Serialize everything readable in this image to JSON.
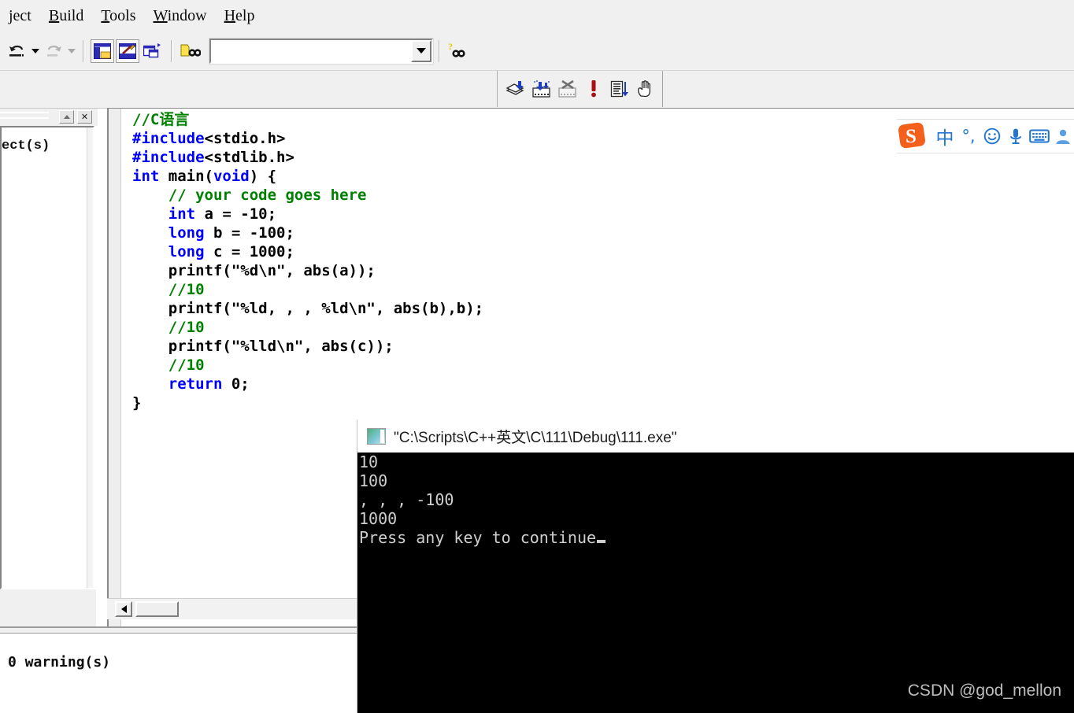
{
  "menu": {
    "items": [
      {
        "label": "ject",
        "accel": ""
      },
      {
        "label": "Build",
        "accel": "B"
      },
      {
        "label": "Tools",
        "accel": "T"
      },
      {
        "label": "Window",
        "accel": "W"
      },
      {
        "label": "Help",
        "accel": "H"
      }
    ]
  },
  "toolbar": {
    "undo_icon": "undo-icon",
    "redo_icon": "redo-icon",
    "workspace_icon": "workspace-toggle-icon",
    "output_icon": "output-toggle-icon",
    "windowlist_icon": "window-list-icon",
    "findfiles_icon": "find-in-files-icon",
    "search_value": "",
    "search_placeholder": "",
    "help_search_icon": "find-in-help-icon"
  },
  "debug_toolbar": {
    "items": [
      {
        "name": "compile-icon"
      },
      {
        "name": "build-icon"
      },
      {
        "name": "stop-build-icon"
      },
      {
        "name": "execute-program-icon"
      },
      {
        "name": "go-icon"
      },
      {
        "name": "insert-breakpoint-icon"
      }
    ]
  },
  "workspace": {
    "title_partial": "ect(s)",
    "collapse_icon": "collapse-icon",
    "close_icon": "close-icon"
  },
  "editor": {
    "lines": [
      [
        {
          "t": "//C语言",
          "c": "cmt"
        }
      ],
      [
        {
          "t": "#include",
          "c": "kw"
        },
        {
          "t": "<stdio.h>",
          "c": "plain"
        }
      ],
      [
        {
          "t": "#include",
          "c": "kw"
        },
        {
          "t": "<stdlib.h>",
          "c": "plain"
        }
      ],
      [
        {
          "t": "int",
          "c": "kw"
        },
        {
          "t": " main(",
          "c": "plain"
        },
        {
          "t": "void",
          "c": "kw"
        },
        {
          "t": ") {",
          "c": "plain"
        }
      ],
      [
        {
          "t": "    ",
          "c": "plain"
        },
        {
          "t": "// your code goes here",
          "c": "cmt"
        }
      ],
      [
        {
          "t": "    ",
          "c": "plain"
        },
        {
          "t": "int",
          "c": "kw"
        },
        {
          "t": " a = -10;",
          "c": "plain"
        }
      ],
      [
        {
          "t": "    ",
          "c": "plain"
        },
        {
          "t": "long",
          "c": "kw"
        },
        {
          "t": " b = -100;",
          "c": "plain"
        }
      ],
      [
        {
          "t": "    ",
          "c": "plain"
        },
        {
          "t": "long",
          "c": "kw"
        },
        {
          "t": " c = 1000;",
          "c": "plain"
        }
      ],
      [
        {
          "t": "    printf(\"%d\\n\", abs(a));",
          "c": "plain"
        }
      ],
      [
        {
          "t": "    ",
          "c": "plain"
        },
        {
          "t": "//10",
          "c": "cmt"
        }
      ],
      [
        {
          "t": "    printf(\"%ld, , , %ld\\n\", abs(b),b);",
          "c": "plain"
        }
      ],
      [
        {
          "t": "    ",
          "c": "plain"
        },
        {
          "t": "//10",
          "c": "cmt"
        }
      ],
      [
        {
          "t": "    printf(\"%lld\\n\", abs(c));",
          "c": "plain"
        }
      ],
      [
        {
          "t": "    ",
          "c": "plain"
        },
        {
          "t": "//10",
          "c": "cmt"
        }
      ],
      [
        {
          "t": "    ",
          "c": "plain"
        },
        {
          "t": "return",
          "c": "kw"
        },
        {
          "t": " 0;",
          "c": "plain"
        }
      ],
      [
        {
          "t": "}",
          "c": "plain"
        }
      ]
    ],
    "hscroll_left_icon": "scroll-left-arrow-icon"
  },
  "output": {
    "text": "0 warning(s)"
  },
  "console": {
    "icon": "console-window-icon",
    "title": "\"C:\\Scripts\\C++英文\\C\\111\\Debug\\111.exe\"",
    "lines": [
      "10",
      "100",
      ", , , -100",
      "1000"
    ],
    "prompt": "Press any key to continue",
    "watermark": "CSDN @god_mellon"
  },
  "ime": {
    "logo_icon": "sogou-logo-icon",
    "items": [
      {
        "name": "chinese-mode-icon",
        "glyph": "中",
        "kind": "cn"
      },
      {
        "name": "punctuation-mode-icon",
        "glyph": "°,",
        "kind": "punct"
      },
      {
        "name": "emoji-icon",
        "glyph": "",
        "kind": "svg-smiley"
      },
      {
        "name": "voice-input-icon",
        "glyph": "",
        "kind": "svg-mic"
      },
      {
        "name": "soft-keyboard-icon",
        "glyph": "",
        "kind": "svg-kbd"
      },
      {
        "name": "user-account-icon",
        "glyph": "",
        "kind": "svg-user"
      }
    ]
  },
  "colors": {
    "keyword": "#0000ff",
    "comment": "#008000",
    "ime_blue": "#2176d2",
    "sogou_orange": "#f4601c",
    "console_bg": "#000000",
    "console_fg": "#cfcfcf"
  }
}
